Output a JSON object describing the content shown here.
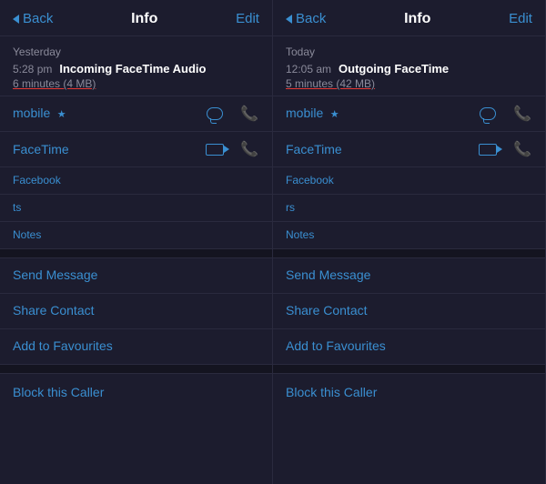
{
  "panels": [
    {
      "id": "left",
      "header": {
        "back_label": "Back",
        "title": "Info",
        "edit_label": "Edit"
      },
      "call": {
        "date": "Yesterday",
        "time": "5:28 pm",
        "type": "Incoming FaceTime Audio",
        "duration": "6 minutes (4 MB)"
      },
      "contact": {
        "label": "mobile",
        "has_star": true
      },
      "facetime_label": "FaceTime",
      "fields": [
        {
          "label": "Facebook",
          "value": ""
        },
        {
          "label": "ts",
          "value": ""
        },
        {
          "label": "Notes",
          "value": ""
        }
      ],
      "actions": [
        {
          "label": "Send Message"
        },
        {
          "label": "Share Contact"
        },
        {
          "label": "Add to Favourites"
        }
      ],
      "block_label": "Block this Caller"
    },
    {
      "id": "right",
      "header": {
        "back_label": "Back",
        "title": "Info",
        "edit_label": "Edit"
      },
      "call": {
        "date": "Today",
        "time": "12:05 am",
        "type": "Outgoing FaceTime",
        "duration": "5 minutes (42 MB)"
      },
      "contact": {
        "label": "mobile",
        "has_star": true
      },
      "facetime_label": "FaceTime",
      "fields": [
        {
          "label": "Facebook",
          "value": ""
        },
        {
          "label": "rs",
          "value": ""
        },
        {
          "label": "Notes",
          "value": ""
        }
      ],
      "actions": [
        {
          "label": "Send Message"
        },
        {
          "label": "Share Contact"
        },
        {
          "label": "Add to Favourites"
        }
      ],
      "block_label": "Block this Caller"
    }
  ]
}
